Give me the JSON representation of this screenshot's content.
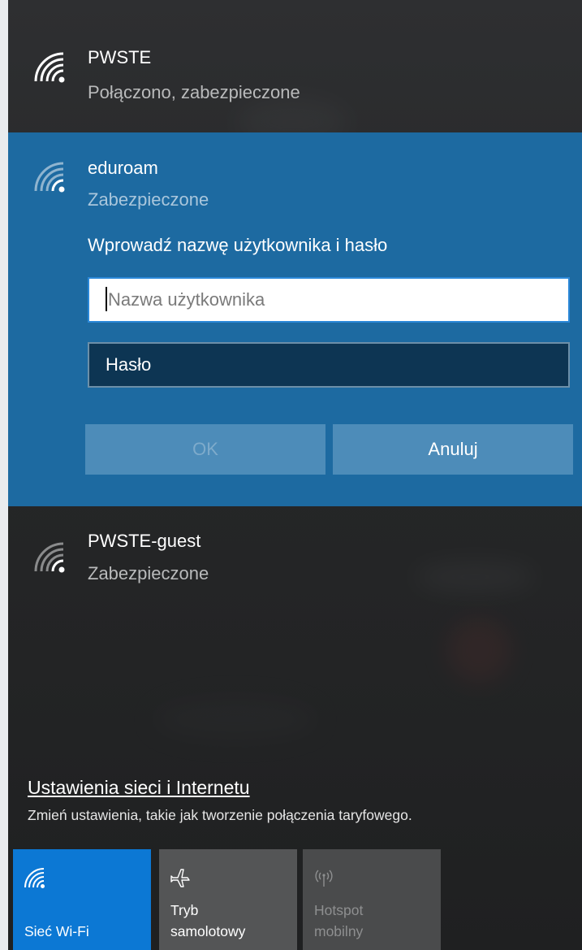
{
  "networks": [
    {
      "name": "PWSTE",
      "status": "Połączono, zabezpieczone",
      "icon": "wifi-icon"
    },
    {
      "name": "eduroam",
      "status": "Zabezpieczone",
      "icon": "wifi-icon"
    },
    {
      "name": "PWSTE-guest",
      "status": "Zabezpieczone",
      "icon": "wifi-icon"
    }
  ],
  "credentials": {
    "prompt": "Wprowadź nazwę użytkownika i hasło",
    "username_placeholder": "Nazwa użytkownika",
    "password_placeholder": "Hasło",
    "ok_label": "OK",
    "cancel_label": "Anuluj"
  },
  "settings": {
    "link": "Ustawienia sieci i Internetu",
    "description": "Zmień ustawienia, takie jak tworzenie połączenia taryfowego."
  },
  "quick_actions": [
    {
      "label": "Sieć Wi-Fi",
      "icon": "wifi-icon",
      "state": "on"
    },
    {
      "label_line1": "Tryb",
      "label_line2": "samolotowy",
      "icon": "airplane-icon",
      "state": "off"
    },
    {
      "label_line1": "Hotspot",
      "label_line2": "mobilny",
      "icon": "hotspot-icon",
      "state": "disabled"
    }
  ],
  "colors": {
    "accent": "#0c78d4",
    "selected_network_bg": "#1d6aa1",
    "panel_bg": "#262728"
  }
}
